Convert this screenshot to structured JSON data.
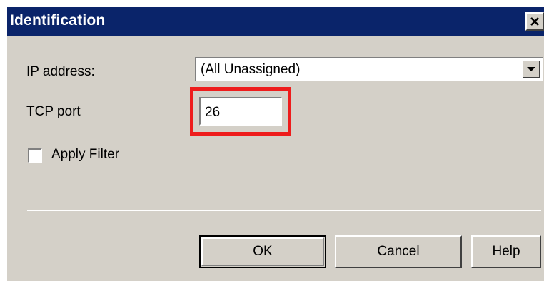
{
  "dialog": {
    "title": "Identification"
  },
  "fields": {
    "ip_label": "IP address:",
    "ip_value": "(All Unassigned)",
    "tcp_label": "TCP port",
    "tcp_value": "26",
    "apply_filter_label": "Apply Filter",
    "apply_filter_checked": false
  },
  "buttons": {
    "ok": "OK",
    "cancel": "Cancel",
    "help": "Help"
  },
  "colors": {
    "titlebar": "#0a246a",
    "dialog_face": "#d4d0c8",
    "highlight": "#ee1c1c"
  },
  "icons": [
    "close-icon",
    "chevron-down-icon"
  ]
}
